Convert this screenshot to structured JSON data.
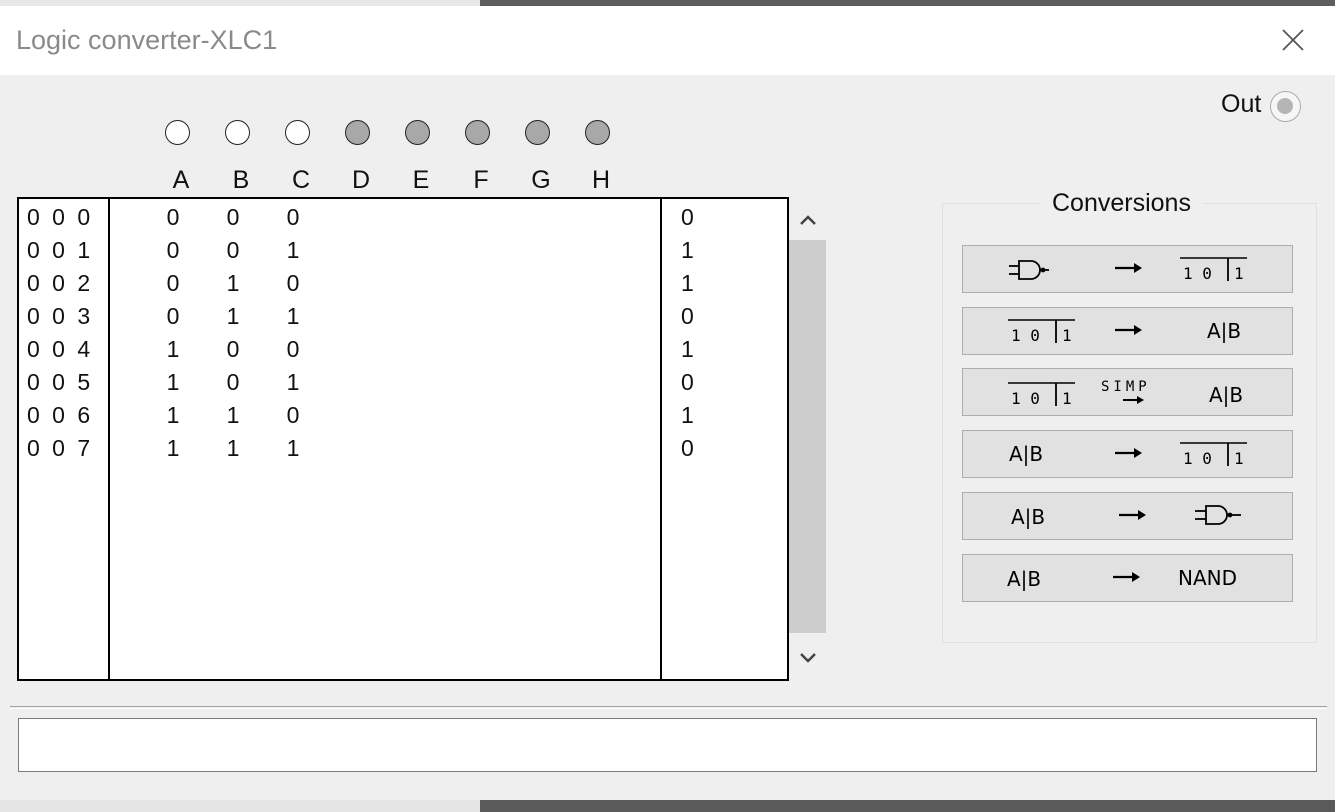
{
  "window": {
    "title": "Logic converter-XLC1",
    "close_icon": "close-icon"
  },
  "output": {
    "label": "Out"
  },
  "inputs": [
    {
      "label": "A",
      "active": true
    },
    {
      "label": "B",
      "active": true
    },
    {
      "label": "C",
      "active": true
    },
    {
      "label": "D",
      "active": false
    },
    {
      "label": "E",
      "active": false
    },
    {
      "label": "F",
      "active": false
    },
    {
      "label": "G",
      "active": false
    },
    {
      "label": "H",
      "active": false
    }
  ],
  "truth_table": {
    "rows": [
      {
        "index": "0 0 0",
        "a": "0",
        "b": "0",
        "c": "0",
        "out": "0"
      },
      {
        "index": "0 0 1",
        "a": "0",
        "b": "0",
        "c": "1",
        "out": "1"
      },
      {
        "index": "0 0 2",
        "a": "0",
        "b": "1",
        "c": "0",
        "out": "1"
      },
      {
        "index": "0 0 3",
        "a": "0",
        "b": "1",
        "c": "1",
        "out": "0"
      },
      {
        "index": "0 0 4",
        "a": "1",
        "b": "0",
        "c": "0",
        "out": "1"
      },
      {
        "index": "0 0 5",
        "a": "1",
        "b": "0",
        "c": "1",
        "out": "0"
      },
      {
        "index": "0 0 6",
        "a": "1",
        "b": "1",
        "c": "0",
        "out": "1"
      },
      {
        "index": "0 0 7",
        "a": "1",
        "b": "1",
        "c": "1",
        "out": "0"
      }
    ]
  },
  "conversions": {
    "title": "Conversions",
    "buttons": [
      {
        "name": "circuit-to-truth-table",
        "from": "gate-icon",
        "to": "truth-table-icon"
      },
      {
        "name": "truth-table-to-expression",
        "from": "truth-table-icon",
        "to": "expression-icon",
        "to_text": "A|B"
      },
      {
        "name": "truth-table-to-simplified-expression",
        "from": "truth-table-icon",
        "mid_text": "SIMP",
        "to": "expression-icon",
        "to_text": "A|B"
      },
      {
        "name": "expression-to-truth-table",
        "from": "expression-icon",
        "from_text": "A|B",
        "to": "truth-table-icon"
      },
      {
        "name": "expression-to-circuit",
        "from": "expression-icon",
        "from_text": "A|B",
        "to": "gate-icon"
      },
      {
        "name": "expression-to-nand",
        "from": "expression-icon",
        "from_text": "A|B",
        "to_text": "NAND"
      }
    ]
  },
  "expression_field": {
    "value": ""
  },
  "colors": {
    "window_bg": "#efefef",
    "titlebar_bg": "#ffffff",
    "button_bg": "#e1e1e1",
    "terminal_inactive": "#a8a8a8"
  }
}
